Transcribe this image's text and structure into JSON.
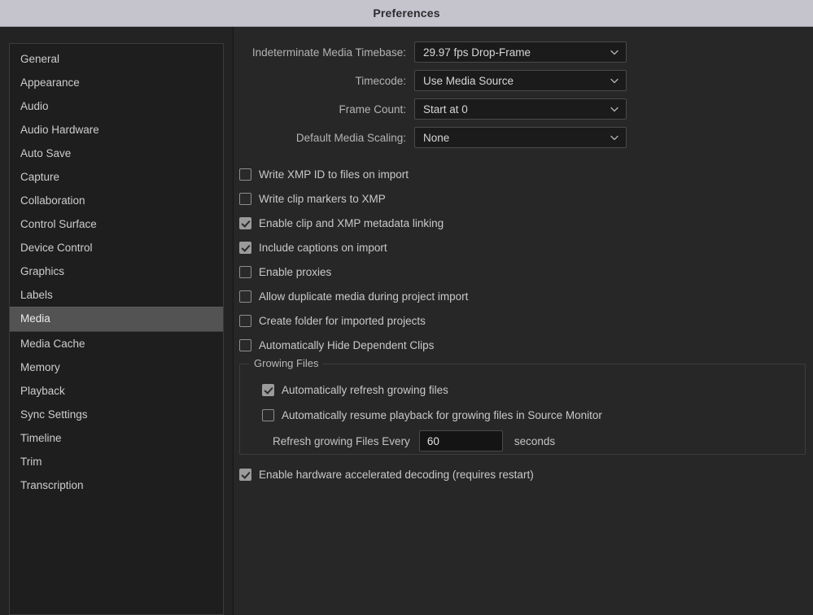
{
  "window": {
    "title": "Preferences"
  },
  "sidebar": {
    "items": [
      {
        "label": "General",
        "selected": false
      },
      {
        "label": "Appearance",
        "selected": false
      },
      {
        "label": "Audio",
        "selected": false
      },
      {
        "label": "Audio Hardware",
        "selected": false
      },
      {
        "label": "Auto Save",
        "selected": false
      },
      {
        "label": "Capture",
        "selected": false
      },
      {
        "label": "Collaboration",
        "selected": false
      },
      {
        "label": "Control Surface",
        "selected": false
      },
      {
        "label": "Device Control",
        "selected": false
      },
      {
        "label": "Graphics",
        "selected": false
      },
      {
        "label": "Labels",
        "selected": false
      },
      {
        "label": "Media",
        "selected": true
      },
      {
        "label": "Media Cache",
        "selected": false
      },
      {
        "label": "Memory",
        "selected": false
      },
      {
        "label": "Playback",
        "selected": false
      },
      {
        "label": "Sync Settings",
        "selected": false
      },
      {
        "label": "Timeline",
        "selected": false
      },
      {
        "label": "Trim",
        "selected": false
      },
      {
        "label": "Transcription",
        "selected": false
      }
    ]
  },
  "media_panel": {
    "selects": [
      {
        "label": "Indeterminate Media Timebase:",
        "value": "29.97 fps Drop-Frame"
      },
      {
        "label": "Timecode:",
        "value": "Use Media Source"
      },
      {
        "label": "Frame Count:",
        "value": "Start at 0"
      },
      {
        "label": "Default Media Scaling:",
        "value": "None"
      }
    ],
    "checkboxes": [
      {
        "label": "Write XMP ID to files on import",
        "checked": false
      },
      {
        "label": "Write clip markers to XMP",
        "checked": false
      },
      {
        "label": "Enable clip and XMP metadata linking",
        "checked": true
      },
      {
        "label": "Include captions on import",
        "checked": true
      },
      {
        "label": "Enable proxies",
        "checked": false
      },
      {
        "label": "Allow duplicate media during project import",
        "checked": false
      },
      {
        "label": "Create folder for imported projects",
        "checked": false
      },
      {
        "label": "Automatically Hide Dependent Clips",
        "checked": false
      }
    ],
    "growing_files": {
      "title": "Growing Files",
      "checkboxes": [
        {
          "label": "Automatically refresh growing files",
          "checked": true
        },
        {
          "label": "Automatically resume playback for growing files in Source Monitor",
          "checked": false
        }
      ],
      "interval": {
        "label": "Refresh growing Files Every",
        "value": "60",
        "suffix": "seconds"
      }
    },
    "footer_checkbox": {
      "label": "Enable hardware accelerated decoding (requires restart)",
      "checked": true
    }
  },
  "colors": {
    "titlebar_bg": "#c5c3cb",
    "dialog_bg": "#232323",
    "panel_bg": "#272727",
    "sidebar_bg": "#1e1e1e",
    "selection_bg": "#535353",
    "text": "#c9c9c9",
    "field_bg": "#1b1b1b",
    "field_border": "#4a4a4a"
  }
}
